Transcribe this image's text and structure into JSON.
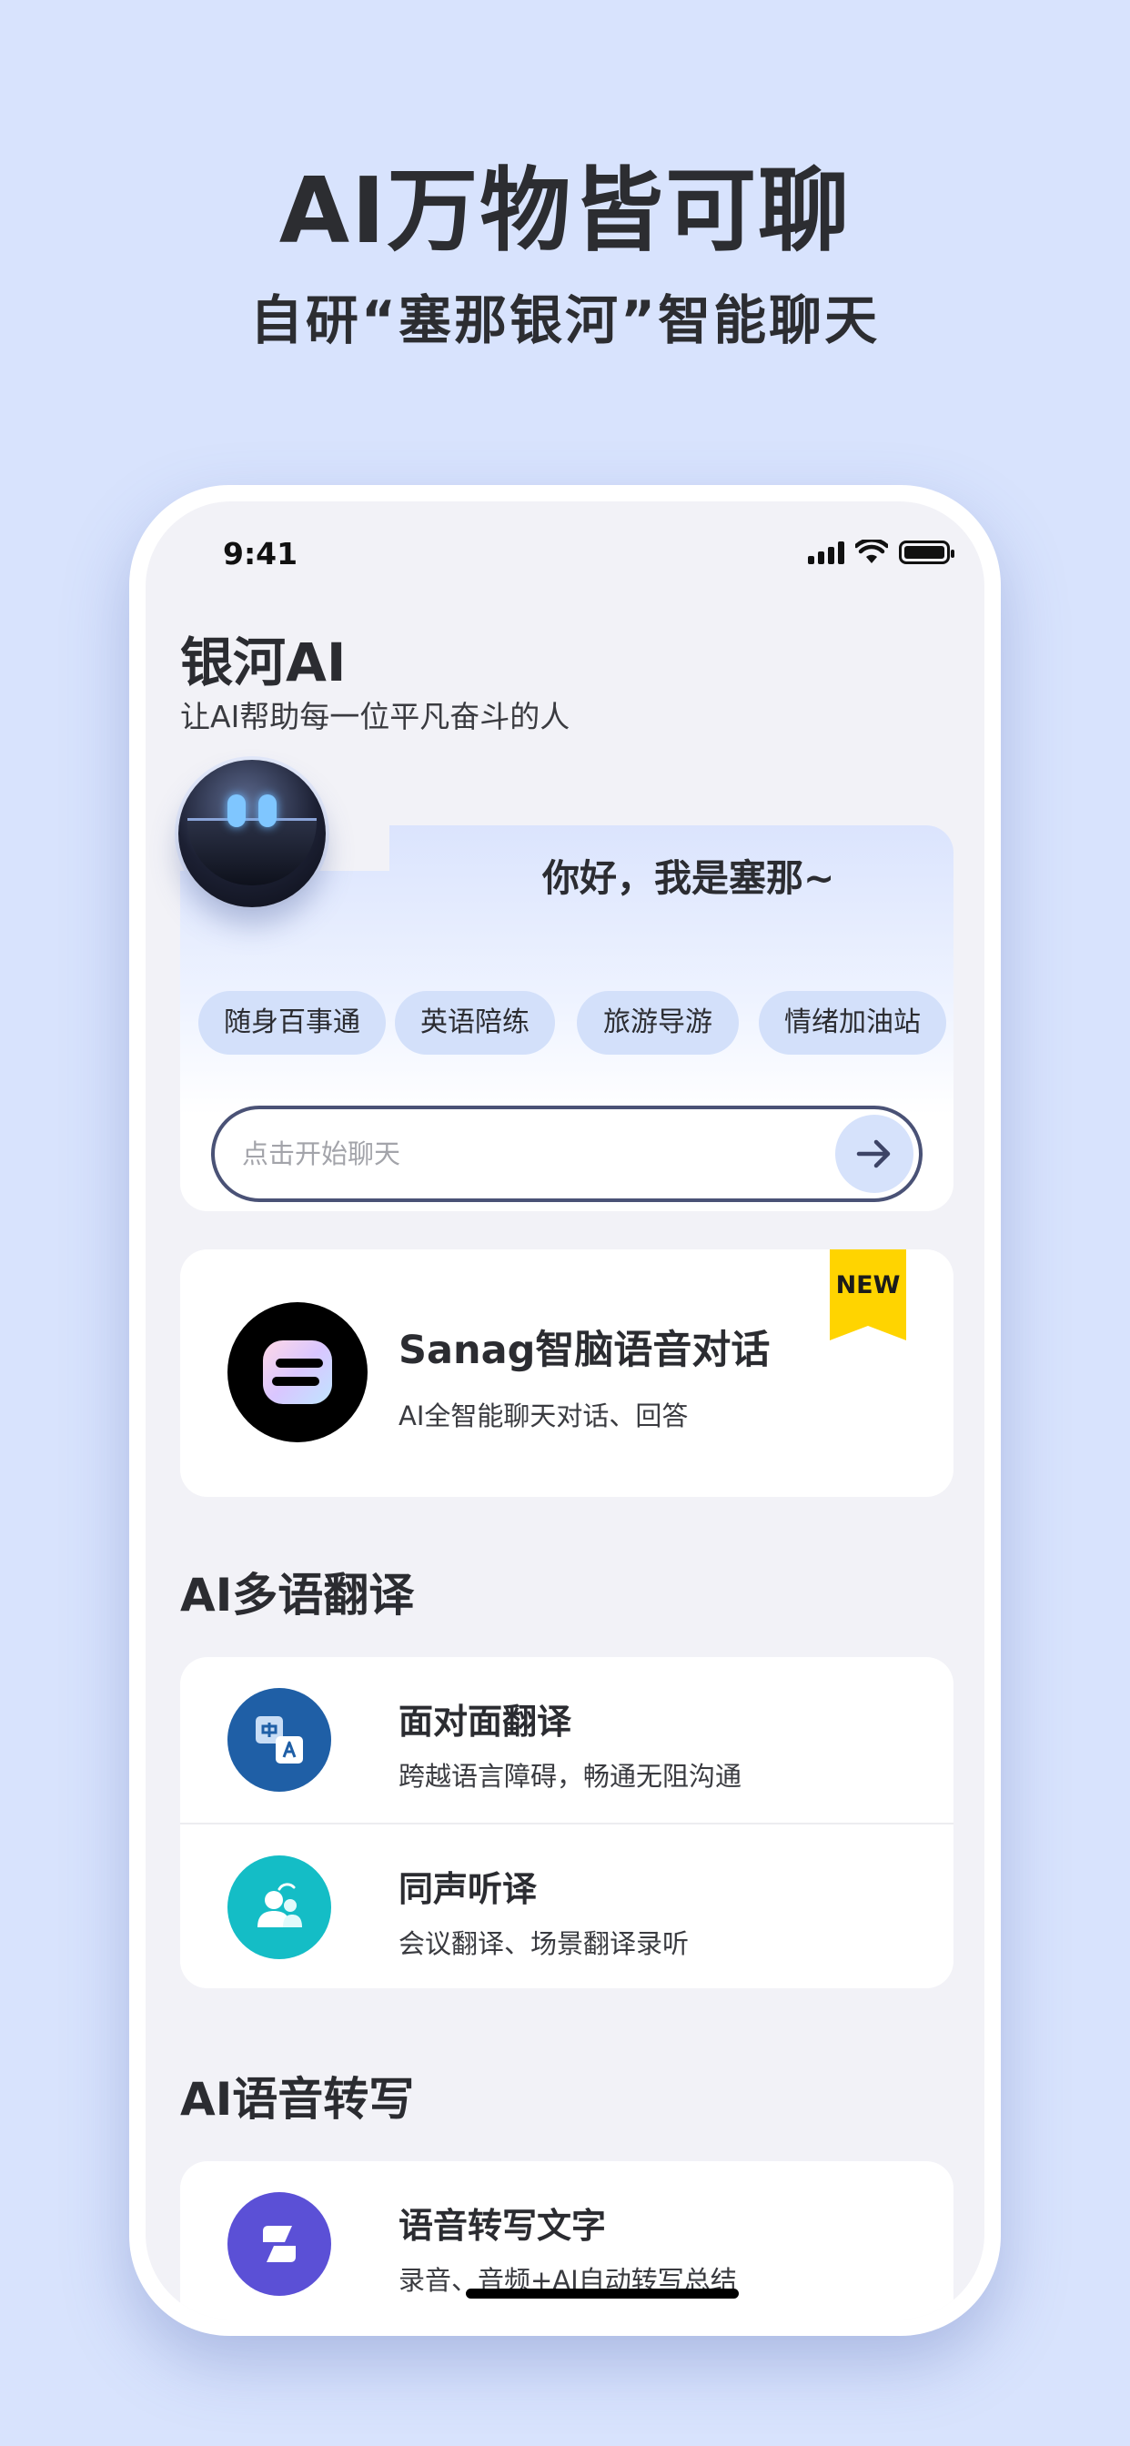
{
  "promo": {
    "title": "AI万物皆可聊",
    "subtitle": "自研“塞那银河”智能聊天"
  },
  "status_bar": {
    "time": "9:41",
    "icons": [
      "cellular-signal-icon",
      "wifi-icon",
      "battery-icon"
    ]
  },
  "header": {
    "title": "银河AI",
    "subtitle": "让AI帮助每一位平凡奋斗的人"
  },
  "chat_card": {
    "greeting": "你好，我是塞那~",
    "chips": [
      "随身百事通",
      "英语陪练",
      "旅游导游",
      "情绪加油站"
    ],
    "input_placeholder": "点击开始聊天",
    "send_icon": "arrow-right-icon"
  },
  "feature": {
    "title": "Sanag智脑语音对话",
    "description": "AI全智能聊天对话、回答",
    "badge": "NEW"
  },
  "translation": {
    "section_title": "AI多语翻译",
    "items": [
      {
        "title": "面对面翻译",
        "description": "跨越语言障碍，畅通无阻沟通",
        "icon": "translate-icon",
        "color": "#1f5fa6"
      },
      {
        "title": "同声听译",
        "description": "会议翻译、场景翻译录听",
        "icon": "people-icon",
        "color": "#14bdc6"
      }
    ]
  },
  "transcription": {
    "section_title": "AI语音转写",
    "items": [
      {
        "title": "语音转写文字",
        "description": "录音、音频+AI自动转写总结",
        "icon": "transcribe-icon",
        "color": "#5b50d6"
      }
    ]
  },
  "colors": {
    "background": "#d8e3fd",
    "chip": "#d3e0fa",
    "badge": "#ffd400",
    "input_border": "#4a5276"
  }
}
